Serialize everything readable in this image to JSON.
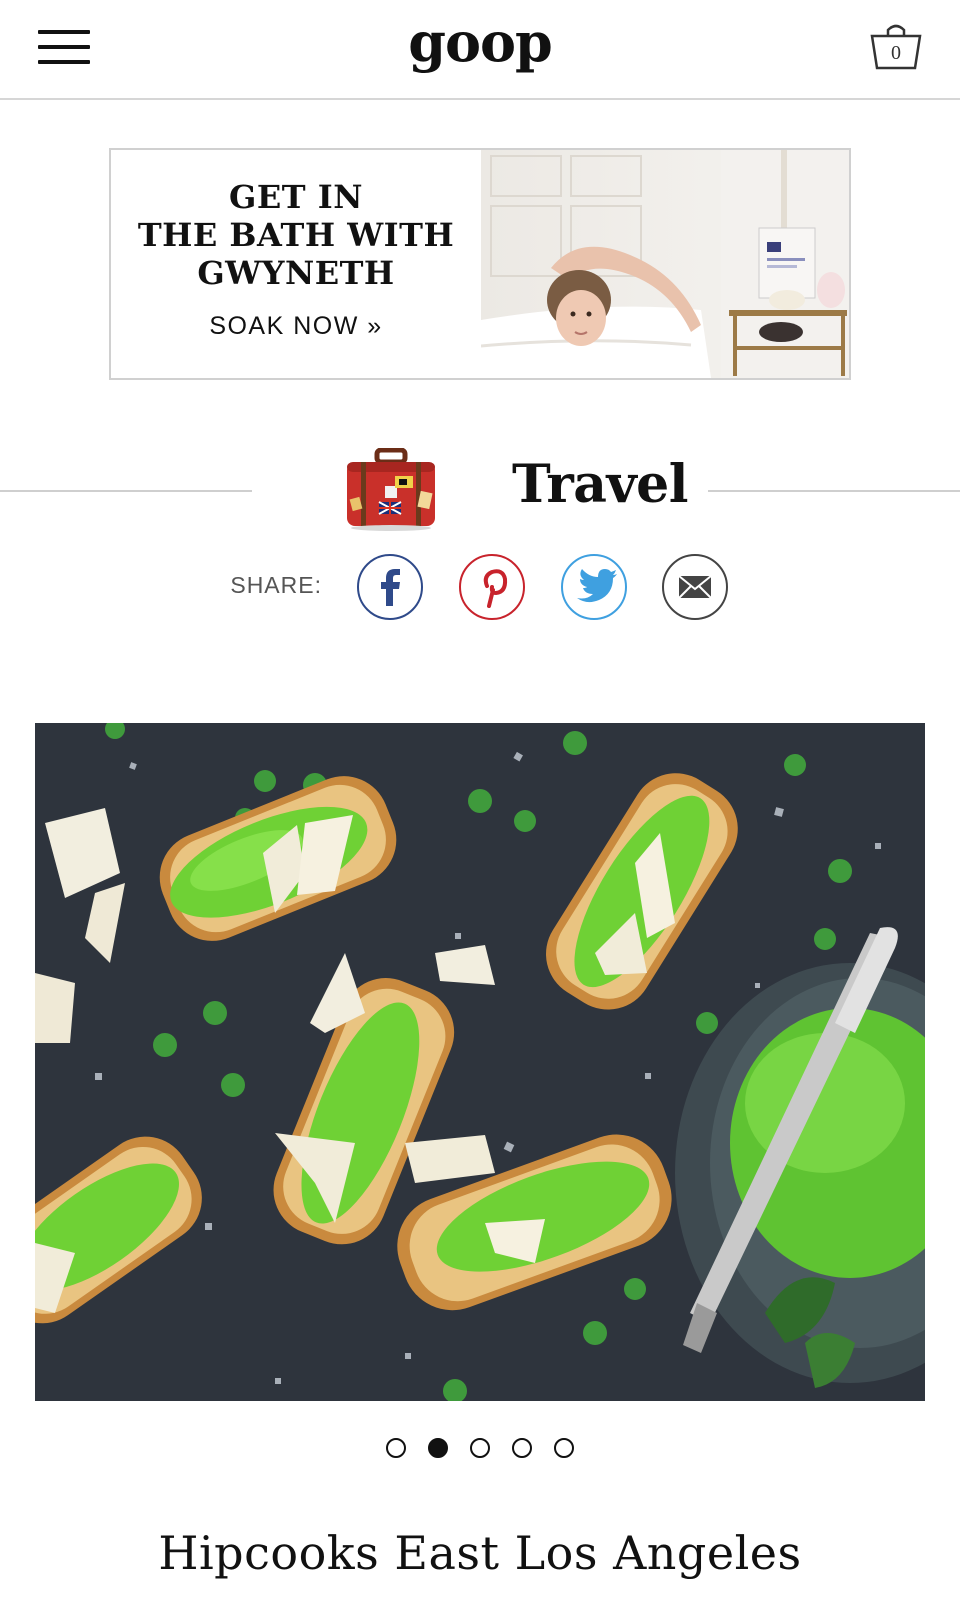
{
  "header": {
    "logo": "goop",
    "cart_count": "0"
  },
  "ad": {
    "headline_line1": "GET IN",
    "headline_line2": "THE BATH WITH",
    "headline_line3": "GWYNETH",
    "cta": "SOAK NOW »"
  },
  "section": {
    "title": "Travel",
    "icon": "suitcase-icon"
  },
  "share": {
    "label": "SHARE:",
    "buttons": [
      {
        "icon": "facebook-icon",
        "color": "#2f4a8a"
      },
      {
        "icon": "pinterest-icon",
        "color": "#c8232c"
      },
      {
        "icon": "twitter-icon",
        "color": "#3fa0e0"
      },
      {
        "icon": "mail-icon",
        "color": "#444444"
      }
    ]
  },
  "carousel": {
    "slide_count": 5,
    "active_index": 1
  },
  "article": {
    "title": "Hipcooks East Los Angeles"
  }
}
